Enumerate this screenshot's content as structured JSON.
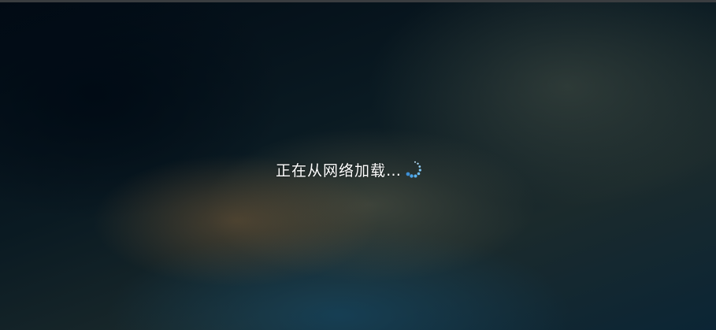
{
  "loading": {
    "message": "正在从网络加载…",
    "spinner_icon": "loading-spinner-icon",
    "spinner_color": "#4aa3e8"
  },
  "colors": {
    "background": "#02080f",
    "top_bar": "#3a3d40",
    "text": "#ffffff"
  }
}
